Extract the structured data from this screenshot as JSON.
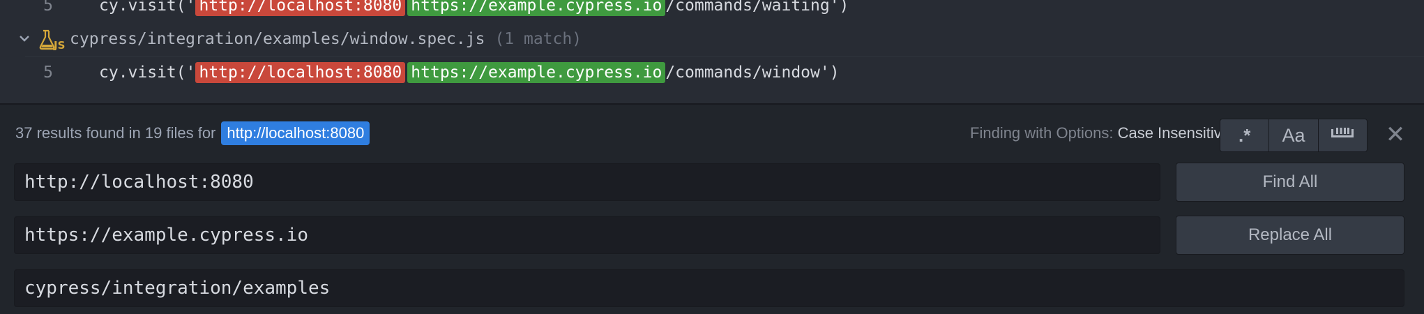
{
  "results": {
    "rows": [
      {
        "line": "5",
        "prefix": "cy.visit('",
        "match": "http://localhost:8080",
        "replacement": "https://example.cypress.io",
        "suffix": "/commands/waiting')"
      },
      {
        "line": "5",
        "prefix": "cy.visit('",
        "match": "http://localhost:8080",
        "replacement": "https://example.cypress.io",
        "suffix": "/commands/window')"
      }
    ],
    "file": {
      "path": "cypress/integration/examples/window.spec.js",
      "count": "(1 match)",
      "icon": "js-test-file-icon"
    }
  },
  "find_panel": {
    "summary_text": "37 results found in 19 files for",
    "summary_query": "http://localhost:8080",
    "options_label": "Finding with Options:",
    "options_value": "Case Insensitive",
    "toggle_regex": ".*",
    "toggle_case": "Aa",
    "toggle_whole_word_icon": "whole-word-icon",
    "close_icon": "✕",
    "find_value": "http://localhost:8080",
    "replace_value": "https://example.cypress.io",
    "paths_value": "cypress/integration/examples",
    "find_all_label": "Find All",
    "replace_all_label": "Replace All"
  },
  "colors": {
    "match_highlight": "#c9483b",
    "replace_highlight": "#3f9a3f",
    "query_badge": "#2f7ee0"
  }
}
